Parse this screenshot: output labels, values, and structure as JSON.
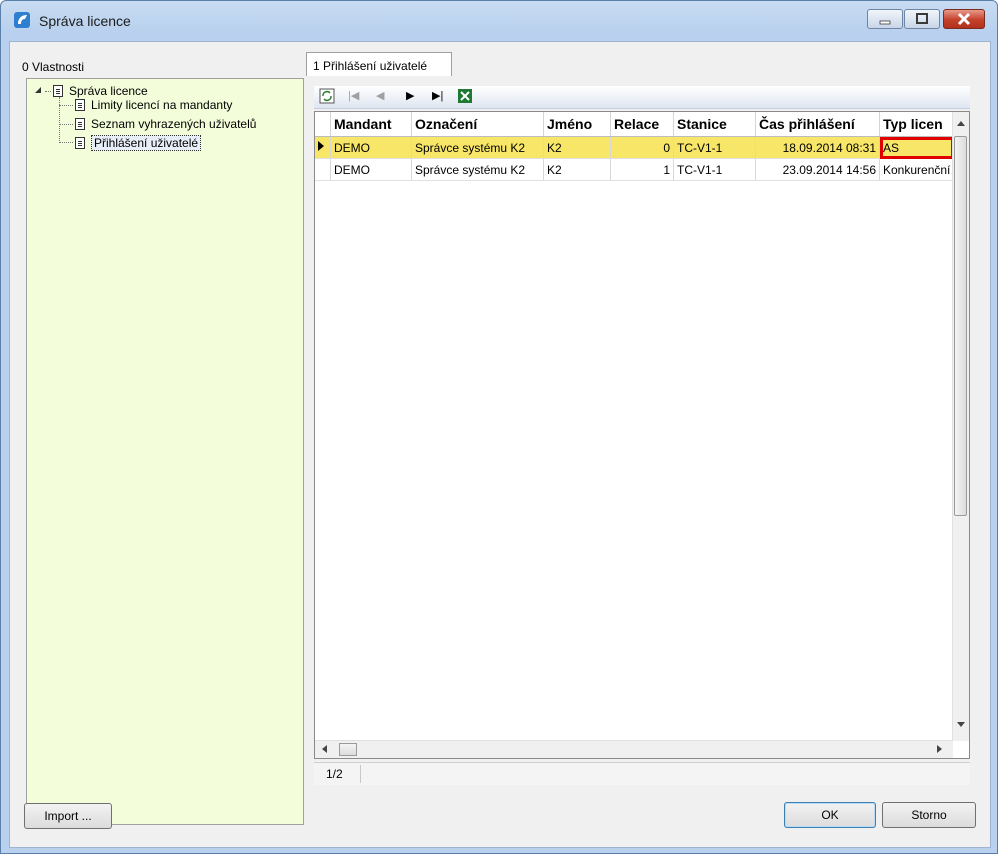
{
  "window": {
    "title": "Správa licence",
    "controls": {
      "minimize": "minimize-icon",
      "maximize": "maximize-icon",
      "close": "close-icon"
    }
  },
  "left_panel": {
    "label": "0 Vlastnosti",
    "tree": {
      "root": "Správa licence",
      "children": [
        "Limity licencí na mandanty",
        "Seznam vyhrazených uživatelů",
        "Přihlášení uživatelé"
      ],
      "selected": "Přihlášení uživatelé"
    }
  },
  "tab": {
    "label": "1 Přihlášení uživatelé"
  },
  "toolbar": {
    "refresh": "refresh-icon",
    "first": "|◀",
    "prev": "◀",
    "next": "▶",
    "last": "▶|",
    "excel": "excel-export-icon"
  },
  "grid": {
    "columns": [
      "Mandant",
      "Označení",
      "Jméno",
      "Relace",
      "Stanice",
      "Čas přihlášení",
      "Typ licen"
    ],
    "rows": [
      {
        "mandant": "DEMO",
        "oznaceni": "Správce systému K2",
        "jmeno": "K2",
        "relace": "0",
        "stanice": "TC-V1-1",
        "cas": "18.09.2014 08:31",
        "typ": "AS"
      },
      {
        "mandant": "DEMO",
        "oznaceni": "Správce systému K2",
        "jmeno": "K2",
        "relace": "1",
        "stanice": "TC-V1-1",
        "cas": "23.09.2014 14:56",
        "typ": "Konkurenční"
      }
    ]
  },
  "status": {
    "page": "1/2"
  },
  "buttons": {
    "import": "Import ...",
    "ok": "OK",
    "cancel": "Storno"
  },
  "colors": {
    "current_row": "#f7e667",
    "tree_bg": "#f4fdda",
    "highlight": "#e00000"
  }
}
